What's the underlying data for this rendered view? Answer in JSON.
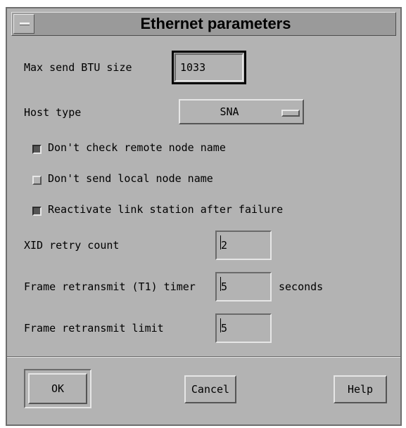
{
  "window": {
    "title": "Ethernet parameters"
  },
  "fields": {
    "max_btu": {
      "label": "Max send BTU size",
      "value": "1033"
    },
    "host_type": {
      "label": "Host type",
      "value": "SNA"
    },
    "xid_retry": {
      "label": "XID retry count",
      "value": "2"
    },
    "t1_timer": {
      "label": "Frame retransmit (T1) timer",
      "value": "5",
      "unit": "seconds"
    },
    "retransmit_limit": {
      "label": "Frame retransmit limit",
      "value": "5"
    }
  },
  "checkboxes": [
    {
      "label": "Don't check remote node name",
      "checked": true
    },
    {
      "label": "Don't send local node name",
      "checked": false
    },
    {
      "label": "Reactivate link station after failure",
      "checked": true
    }
  ],
  "buttons": {
    "ok": "OK",
    "cancel": "Cancel",
    "help": "Help"
  },
  "colors": {
    "background": "#b3b3b3",
    "title_bar": "#9a9a9a",
    "shadow": "#555555",
    "highlight": "#e6e6e6"
  },
  "icons": {
    "window_menu": "window-menu-icon",
    "option_indicator": "option-menu-indicator-icon"
  }
}
